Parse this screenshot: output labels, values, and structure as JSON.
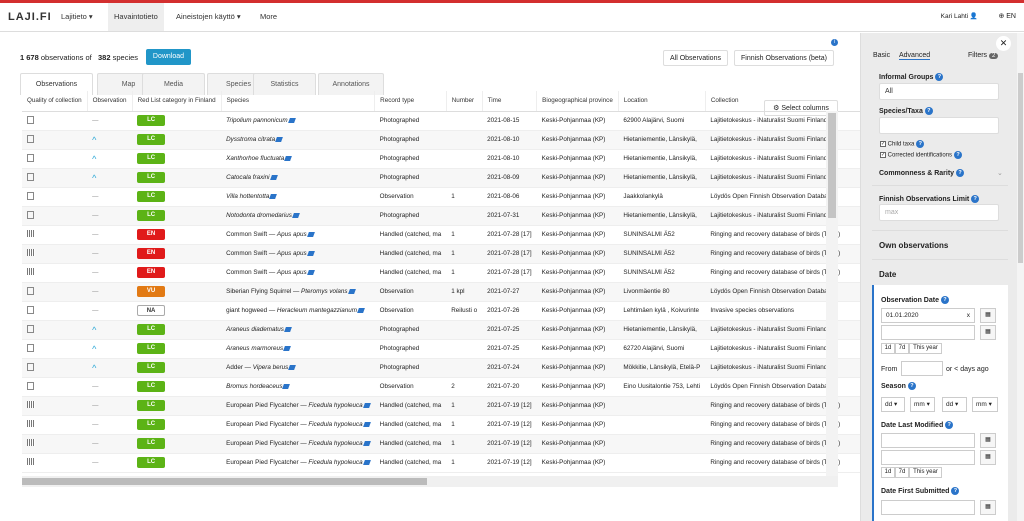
{
  "nav": {
    "logo": "LAJI.FI",
    "items": [
      "Lajitieto ▾",
      "Havaintotieto",
      "Aineistojen käyttö ▾",
      "More"
    ],
    "user": "Kari Lahti",
    "lang": "EN"
  },
  "summary": {
    "obs_count": "1 678",
    "obs_text": "observations of",
    "species_count": "382",
    "species_text": "species"
  },
  "buttons": {
    "download": "Download",
    "all_obs": "All Observations",
    "finnish_obs": "Finnish Observations (beta)",
    "select_columns": "⚙ Select columns"
  },
  "tabs": [
    "Observations",
    "Map",
    "Media",
    "Species",
    "Statistics",
    "Annotations"
  ],
  "columns": [
    "Quality of collection",
    "Observation",
    "Red List category in Finland",
    "Species",
    "Record type",
    "Number",
    "Time",
    "Biogeographical province",
    "Location",
    "Collection",
    "Country"
  ],
  "rows": [
    [
      "doc",
      "dash",
      "LC",
      "",
      "Tripolium pannonicum",
      "Photographed",
      "",
      "2021-08-15",
      "Keski-Pohjanmaa (KP)",
      "62900 Alajärvi, Suomi",
      "Lajitietokeskus - iNaturalist Suomi Finland",
      "Suom"
    ],
    [
      "doc",
      "up",
      "LC",
      "",
      "Dysstroma citrata",
      "Photographed",
      "",
      "2021-08-10",
      "Keski-Pohjanmaa (KP)",
      "Hietaniementie, Länsikylä,",
      "Lajitietokeskus - iNaturalist Suomi Finland",
      "Suom"
    ],
    [
      "doc",
      "up",
      "LC",
      "",
      "Xanthorhoe fluctuata",
      "Photographed",
      "",
      "2021-08-10",
      "Keski-Pohjanmaa (KP)",
      "Hietaniementie, Länsikylä,",
      "Lajitietokeskus - iNaturalist Suomi Finland",
      "Suom"
    ],
    [
      "doc",
      "up",
      "LC",
      "",
      "Catocala fraxini",
      "Photographed",
      "",
      "2021-08-09",
      "Keski-Pohjanmaa (KP)",
      "Hietaniementie, Länsikylä,",
      "Lajitietokeskus - iNaturalist Suomi Finland",
      "Suom"
    ],
    [
      "doc",
      "dash",
      "LC",
      "",
      "Villa hottentotta",
      "Observation",
      "1",
      "2021-08-06",
      "Keski-Pohjanmaa (KP)",
      "Jaakkolankylä",
      "Löydös Open Finnish Observation Database",
      "Suom"
    ],
    [
      "doc",
      "dash",
      "LC",
      "",
      "Notodonta dromedarius",
      "Photographed",
      "",
      "2021-07-31",
      "Keski-Pohjanmaa (KP)",
      "Hietaniementie, Länsikylä,",
      "Lajitietokeskus - iNaturalist Suomi Finland",
      "Suom"
    ],
    [
      "bar",
      "dash",
      "EN",
      "Common Swift — ",
      "Apus apus",
      "Handled (catched, ma",
      "1",
      "2021-07-28 [17]",
      "Keski-Pohjanmaa (KP)",
      "SUNINSALMI Ä52",
      "Ringing and recovery database of birds (TIPU)",
      "Suom"
    ],
    [
      "bar",
      "dash",
      "EN",
      "Common Swift — ",
      "Apus apus",
      "Handled (catched, ma",
      "1",
      "2021-07-28 [17]",
      "Keski-Pohjanmaa (KP)",
      "SUNINSALMI Ä52",
      "Ringing and recovery database of birds (TIPU)",
      "Suom"
    ],
    [
      "bar",
      "dash",
      "EN",
      "Common Swift — ",
      "Apus apus",
      "Handled (catched, ma",
      "1",
      "2021-07-28 [17]",
      "Keski-Pohjanmaa (KP)",
      "SUNINSALMI Ä52",
      "Ringing and recovery database of birds (TIPU)",
      "Suom"
    ],
    [
      "doc",
      "dash",
      "VU",
      "Siberian Flying Squirrel — ",
      "Pteromys volans",
      "Observation",
      "1 kpl",
      "2021-07-27",
      "Keski-Pohjanmaa (KP)",
      "Livonmäentie 80",
      "Löydös Open Finnish Observation Database",
      "Suom"
    ],
    [
      "doc",
      "dash",
      "NA",
      "giant hogweed — ",
      "Heracleum mantegazzianum",
      "Observation",
      "Reilusti o",
      "2021-07-26",
      "Keski-Pohjanmaa (KP)",
      "Lehtimäen kylä , Koivurinte",
      "Invasive species observations",
      "Suom"
    ],
    [
      "doc",
      "up",
      "LC",
      "",
      "Araneus diadematus",
      "Photographed",
      "",
      "2021-07-25",
      "Keski-Pohjanmaa (KP)",
      "Hietaniementie, Länsikylä,",
      "Lajitietokeskus - iNaturalist Suomi Finland",
      "Suom"
    ],
    [
      "doc",
      "up",
      "LC",
      "",
      "Araneus marmoreus",
      "Photographed",
      "",
      "2021-07-25",
      "Keski-Pohjanmaa (KP)",
      "62720 Alajärvi, Suomi",
      "Lajitietokeskus - iNaturalist Suomi Finland",
      "Suom"
    ],
    [
      "doc",
      "up",
      "LC",
      "Adder — ",
      "Vipera berus",
      "Photographed",
      "",
      "2021-07-24",
      "Keski-Pohjanmaa (KP)",
      "Mökkitie, Länsikylä, Etelä-P",
      "Lajitietokeskus - iNaturalist Suomi Finland",
      "Suom"
    ],
    [
      "doc",
      "dash",
      "LC",
      "",
      "Bromus hordeaceus",
      "Observation",
      "2",
      "2021-07-20",
      "Keski-Pohjanmaa (KP)",
      "Eino Uusitalontie 753, Lehti",
      "Löydös Open Finnish Observation Database",
      "Suom"
    ],
    [
      "bar",
      "dash",
      "LC",
      "European Pied Flycatcher — ",
      "Ficedula hypoleuca",
      "Handled (catched, ma",
      "1",
      "2021-07-19 [12]",
      "Keski-Pohjanmaa (KP)",
      "",
      "Ringing and recovery database of birds (TIPU)",
      "Suom"
    ],
    [
      "bar",
      "dash",
      "LC",
      "European Pied Flycatcher — ",
      "Ficedula hypoleuca",
      "Handled (catched, ma",
      "1",
      "2021-07-19 [12]",
      "Keski-Pohjanmaa (KP)",
      "",
      "Ringing and recovery database of birds (TIPU)",
      "Suom"
    ],
    [
      "bar",
      "dash",
      "LC",
      "European Pied Flycatcher — ",
      "Ficedula hypoleuca",
      "Handled (catched, ma",
      "1",
      "2021-07-19 [12]",
      "Keski-Pohjanmaa (KP)",
      "",
      "Ringing and recovery database of birds (TIPU)",
      "Suom"
    ],
    [
      "bar",
      "dash",
      "LC",
      "European Pied Flycatcher — ",
      "Ficedula hypoleuca",
      "Handled (catched, ma",
      "1",
      "2021-07-19 [12]",
      "Keski-Pohjanmaa (KP)",
      "",
      "Ringing and recovery database of birds (TIPU)",
      "Suom"
    ]
  ],
  "panel": {
    "tab_basic": "Basic",
    "tab_advanced": "Advanced",
    "filters_label": "Filters",
    "filters_count": "2",
    "informal_groups": "Informal Groups",
    "informal_value": "All",
    "species_taxa": "Species/Taxa",
    "child_taxa": "Child taxa",
    "corrected_ids": "Corrected identifications",
    "commonness": "Commonness & Rarity",
    "finnish_limit": "Finnish Observations Limit",
    "limit_placeholder": "max",
    "own_obs": "Own observations",
    "date": "Date",
    "obs_date": "Observation Date",
    "obs_date_value": "01.01.2020",
    "q1d": "1d",
    "q7d": "7d",
    "qyear": "This year",
    "from": "From",
    "days_ago": "or < days ago",
    "season": "Season",
    "dd": "dd",
    "mm": "mm",
    "date_last_modified": "Date Last Modified",
    "date_first_submitted": "Date First Submitted"
  }
}
